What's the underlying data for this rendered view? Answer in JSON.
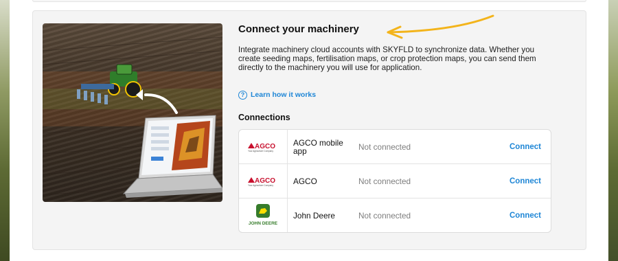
{
  "section": {
    "title": "Connect your machinery",
    "description": "Integrate machinery cloud accounts with SKYFLD to synchronize data. Whether you create seeding maps, fertilisation maps, or crop protection maps, you can send them directly to the machinery you will use for application.",
    "learn_link": "Learn how it works",
    "connections_heading": "Connections"
  },
  "connections": [
    {
      "name": "AGCO mobile app",
      "status": "Not connected",
      "action": "Connect",
      "logo": "agco-logo",
      "logo_text": "AGCO",
      "logo_tagline": "Your Agriculture Company"
    },
    {
      "name": "AGCO",
      "status": "Not connected",
      "action": "Connect",
      "logo": "agco-logo",
      "logo_text": "AGCO",
      "logo_tagline": "Your Agriculture Company"
    },
    {
      "name": "John Deere",
      "status": "Not connected",
      "action": "Connect",
      "logo": "john-deere-logo",
      "logo_text": "JOHN DEERE"
    }
  ],
  "colors": {
    "link_blue": "#1e86d6",
    "agco_red": "#c8102e",
    "deere_green": "#367c2b",
    "deere_yellow": "#ffde00",
    "arrow_yellow": "#f3b41b"
  }
}
